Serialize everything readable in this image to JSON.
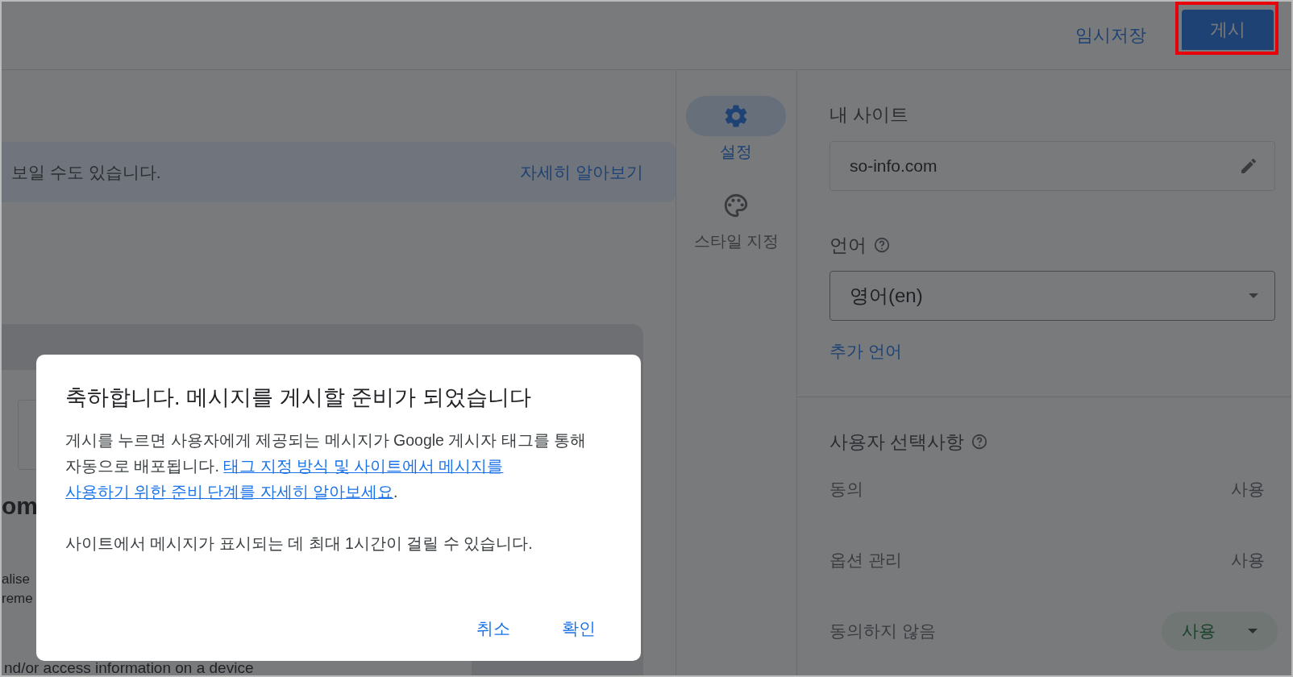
{
  "header": {
    "draft_button": "임시저장",
    "publish_button": "게시",
    "publish_highlighted": true
  },
  "banner": {
    "text": "보일 수도 있습니다.",
    "link": "자세히 알아보기"
  },
  "preview": {
    "heading": "om",
    "lines": [
      "alise",
      "reme"
    ],
    "footer": "nd/or access information on a device"
  },
  "nav": [
    {
      "kind": "settings",
      "label": "설정",
      "selected": true
    },
    {
      "kind": "style",
      "label": "스타일 지정",
      "selected": false
    }
  ],
  "settings": {
    "site_label": "내 사이트",
    "site_value": "so-info.com",
    "language_label": "언어",
    "language_value": "영어(en)",
    "add_language": "추가 언어",
    "choices_label": "사용자 선택사항",
    "choices": [
      {
        "kind": "text",
        "label": "동의",
        "value": "사용"
      },
      {
        "kind": "text",
        "label": "옵션 관리",
        "value": "사용"
      },
      {
        "kind": "dropdown",
        "label": "동의하지 않음",
        "value": "사용"
      }
    ]
  },
  "dialog": {
    "title": "축하합니다. 메시지를 게시할 준비가 되었습니다",
    "body_text": "게시를 누르면 사용자에게 제공되는 메시지가 Google 게시자 태그를 통해 자동으로 배포됩니다.",
    "body_link_lines": [
      "태그 지정 방식 및 사이트에서 메시지를",
      "사용하기 위한 준비 단계를 자세히 알아보세요"
    ],
    "body_end": ".",
    "note": "사이트에서 메시지가 표시되는 데 최대 1시간이 걸릴 수 있습니다.",
    "buttons": [
      "취소",
      "확인"
    ]
  }
}
